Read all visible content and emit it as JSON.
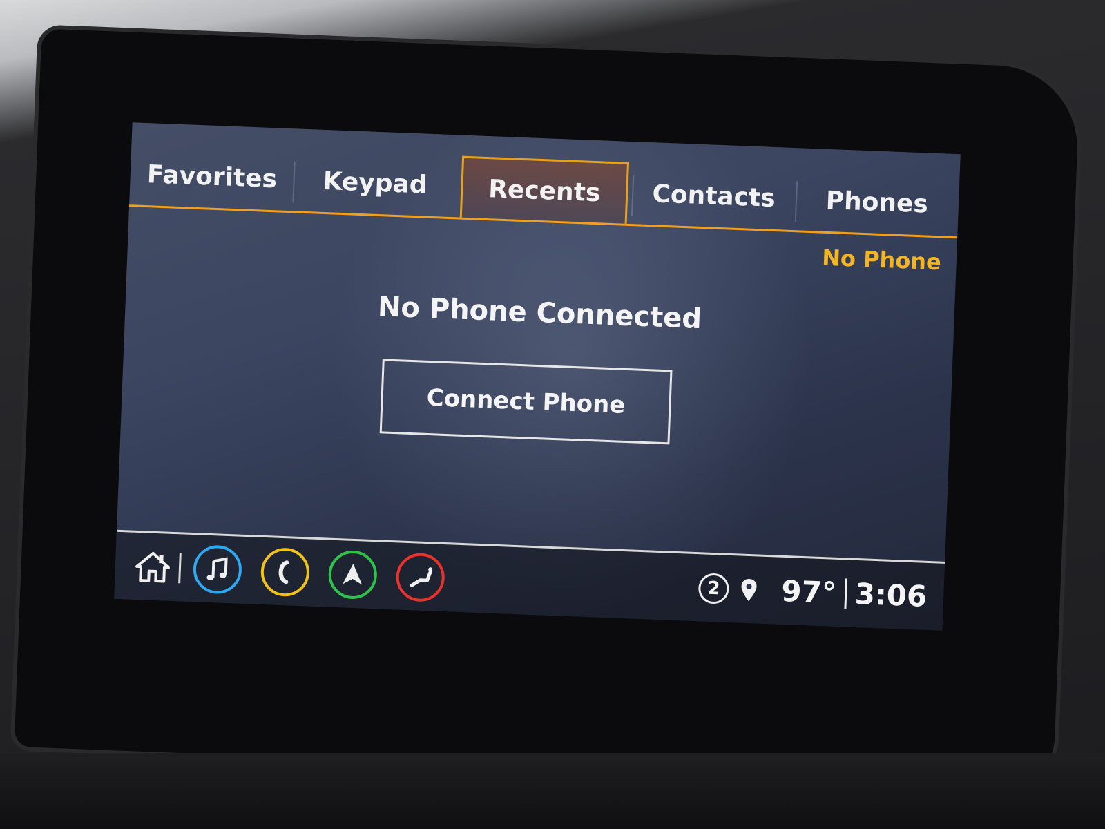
{
  "tabs": [
    {
      "label": "Favorites",
      "active": false
    },
    {
      "label": "Keypad",
      "active": false
    },
    {
      "label": "Recents",
      "active": true
    },
    {
      "label": "Contacts",
      "active": false
    },
    {
      "label": "Phones",
      "active": false
    }
  ],
  "status": {
    "label": "No Phone"
  },
  "main": {
    "message": "No Phone Connected",
    "connect_button": "Connect Phone"
  },
  "bottom_bar": {
    "apps": [
      {
        "icon": "music-note-icon",
        "color": "#2ea8ee"
      },
      {
        "icon": "phone-icon",
        "color": "#f2c21a"
      },
      {
        "icon": "navigation-arrow-icon",
        "color": "#2ec24a"
      },
      {
        "icon": "seat-icon",
        "color": "#e8322a"
      }
    ],
    "notification_count": "2",
    "temperature": "97°",
    "time": "3:06"
  },
  "colors": {
    "accent": "#f0a01c",
    "status_text": "#f4b524"
  }
}
